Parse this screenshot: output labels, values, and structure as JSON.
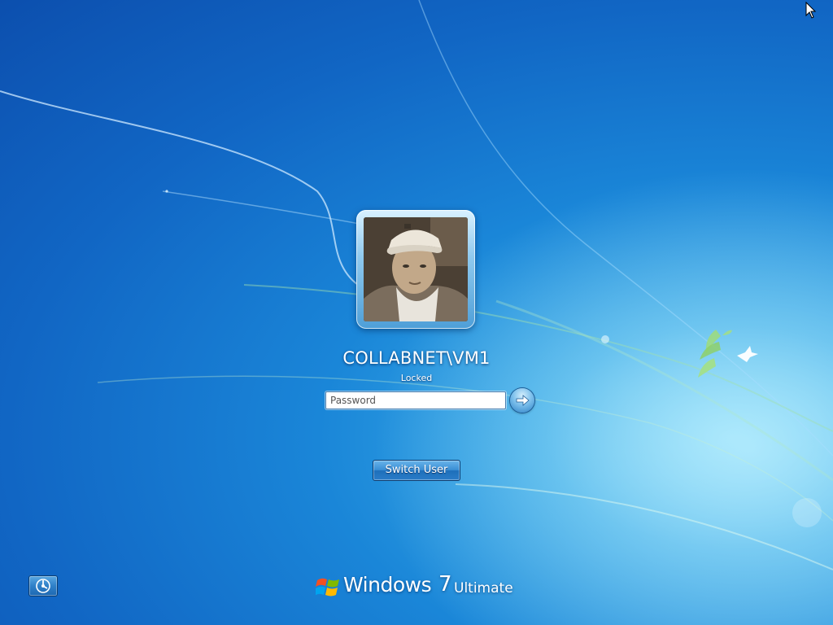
{
  "user": {
    "name": "COLLABNET\\VM1",
    "status": "Locked"
  },
  "login": {
    "password_placeholder": "Password",
    "submit_icon": "arrow-right-icon"
  },
  "actions": {
    "switch_user_label": "Switch User",
    "ease_of_access_icon": "ease-of-access-icon"
  },
  "branding": {
    "windows": "Windows",
    "version": "7",
    "edition": "Ultimate",
    "logo_icon": "windows-flag-icon"
  },
  "colors": {
    "background_deep": "#0c4fae",
    "background_light": "#7fd6f5",
    "button_blue": "#2a7cc8"
  }
}
